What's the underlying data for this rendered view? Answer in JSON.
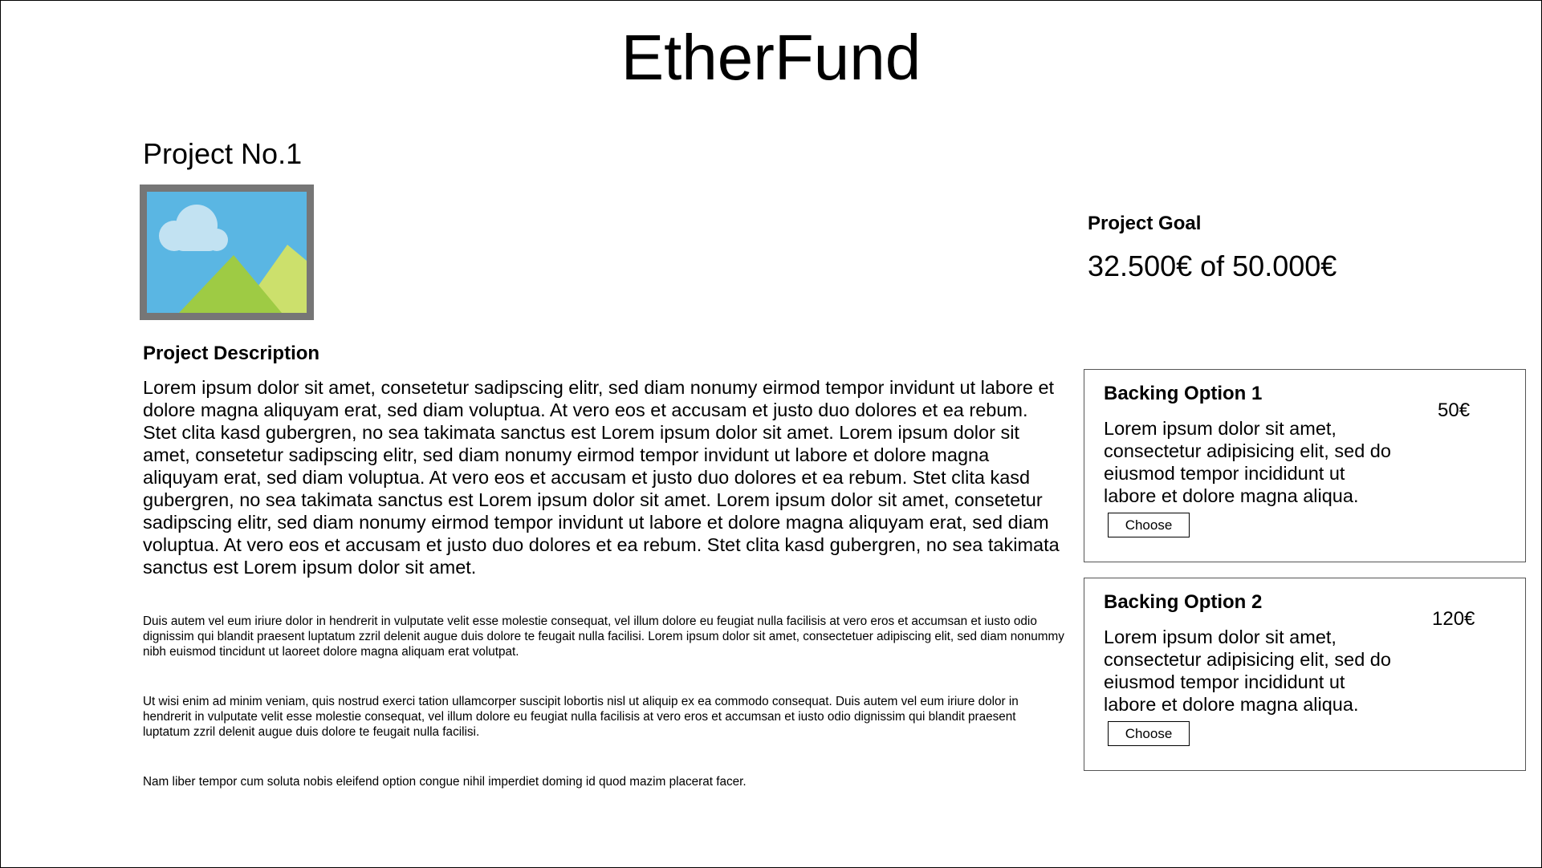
{
  "app": {
    "title": "EtherFund"
  },
  "project": {
    "title": "Project No.1",
    "image_icon": "landscape-picture-icon",
    "description_heading": "Project Description",
    "description_main": "Lorem ipsum dolor sit amet, consetetur sadipscing elitr, sed diam nonumy eirmod tempor invidunt ut labore et dolore magna aliquyam erat, sed diam voluptua. At vero eos et accusam et justo duo dolores et ea rebum. Stet clita kasd gubergren, no sea takimata sanctus est Lorem ipsum dolor sit amet. Lorem ipsum dolor sit amet, consetetur sadipscing elitr, sed diam nonumy eirmod tempor invidunt ut labore et dolore magna aliquyam erat, sed diam voluptua. At vero eos et accusam et justo duo dolores et ea rebum. Stet clita kasd gubergren, no sea takimata sanctus est Lorem ipsum dolor sit amet. Lorem ipsum dolor sit amet, consetetur sadipscing elitr, sed diam nonumy eirmod tempor invidunt ut labore et dolore magna aliquyam erat, sed diam voluptua. At vero eos et accusam et justo duo dolores et ea rebum. Stet clita kasd gubergren, no sea takimata sanctus est Lorem ipsum dolor sit amet.",
    "paragraphs": [
      "Duis autem vel eum iriure dolor in hendrerit in vulputate velit esse molestie consequat, vel illum dolore eu feugiat nulla facilisis at vero eros et accumsan et iusto odio dignissim qui blandit praesent luptatum zzril delenit augue duis dolore te feugait nulla facilisi. Lorem ipsum dolor sit amet, consectetuer adipiscing elit, sed diam nonummy nibh euismod tincidunt ut laoreet dolore magna aliquam erat volutpat.",
      "Ut wisi enim ad minim veniam, quis nostrud exerci tation ullamcorper suscipit lobortis nisl ut aliquip ex ea commodo consequat. Duis autem vel eum iriure dolor in hendrerit in vulputate velit esse molestie consequat, vel illum dolore eu feugiat nulla facilisis at vero eros et accumsan et iusto odio dignissim qui blandit praesent luptatum zzril delenit augue duis dolore te feugait nulla facilisi.",
      "Nam liber tempor cum soluta nobis eleifend option congue nihil imperdiet doming id quod mazim placerat facer."
    ]
  },
  "goal": {
    "label": "Project Goal",
    "value": "32.500€ of 50.000€"
  },
  "backing_options": [
    {
      "title": "Backing Option 1",
      "price": "50€",
      "description": "Lorem ipsum dolor sit amet, consectetur adipisicing elit, sed do eiusmod tempor incididunt ut labore et dolore magna aliqua.",
      "button_label": "Choose"
    },
    {
      "title": "Backing Option 2",
      "price": "120€",
      "description": "Lorem ipsum dolor sit amet, consectetur adipisicing elit, sed do eiusmod tempor incididunt ut labore et dolore magna aliqua.",
      "button_label": "Choose"
    }
  ],
  "colors": {
    "image_frame": "#767676",
    "sky": "#5ab6e3",
    "cloud": "#c2e2f2",
    "hill_front": "#9ecb44",
    "hill_back": "#cce06c",
    "card_border": "#555555"
  }
}
